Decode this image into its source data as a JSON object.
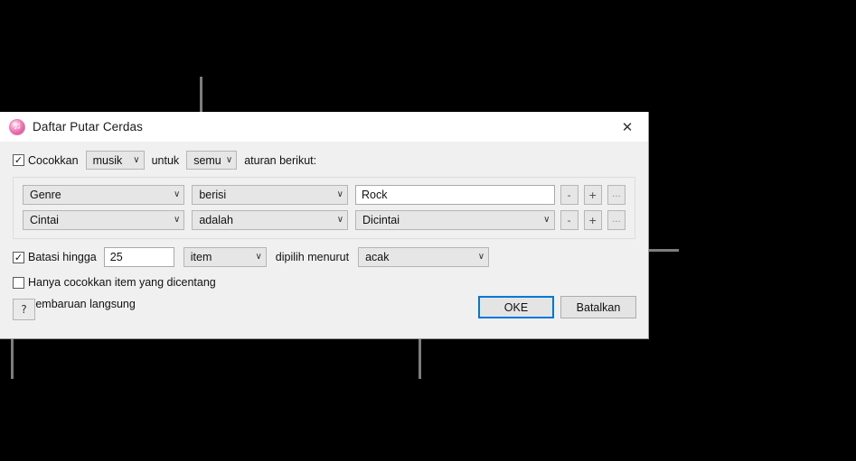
{
  "window": {
    "title": "Daftar Putar Cerdas",
    "icon": "itunes-note-icon",
    "close_label": "✕"
  },
  "match_row": {
    "checkbox_checked": true,
    "checkbox_glyph": "✓",
    "label": "Cocokkan",
    "media_select": {
      "value": "musik",
      "chevron": "∨"
    },
    "untuk_label": "untuk",
    "scope_select": {
      "value": "semua",
      "chevron": "∨"
    },
    "suffix_label": "aturan berikut:"
  },
  "rules": [
    {
      "field": "Genre",
      "operator": "berisi",
      "value": "Rock",
      "value_kind": "text",
      "remove_label": "-",
      "add_label": "+",
      "more_label": "..."
    },
    {
      "field": "Cintai",
      "operator": "adalah",
      "value": "Dicintai",
      "value_kind": "select",
      "remove_label": "-",
      "add_label": "+",
      "more_label": "..."
    }
  ],
  "limit": {
    "checkbox_checked": true,
    "checkbox_glyph": "✓",
    "label": "Batasi hingga",
    "amount": "25",
    "unit_select": {
      "value": "item",
      "chevron": "∨"
    },
    "middle_label": "dipilih menurut",
    "order_select": {
      "value": "acak",
      "chevron": "∨"
    }
  },
  "checked_only": {
    "checkbox_checked": false,
    "checkbox_glyph": "✓",
    "label": "Hanya cocokkan item yang dicentang"
  },
  "live_update": {
    "checkbox_checked": true,
    "checkbox_glyph": "✓",
    "label": "Pembaruan langsung"
  },
  "footer": {
    "help_label": "?",
    "ok_label": "OKE",
    "cancel_label": "Batalkan"
  },
  "chevron": "∨",
  "colors": {
    "background": "#000000",
    "dialog": "#f0f0f0",
    "titlebar": "#ffffff",
    "accent": "#0078d7",
    "callout": "#7d7d7d",
    "control": "#e6e6e6"
  }
}
